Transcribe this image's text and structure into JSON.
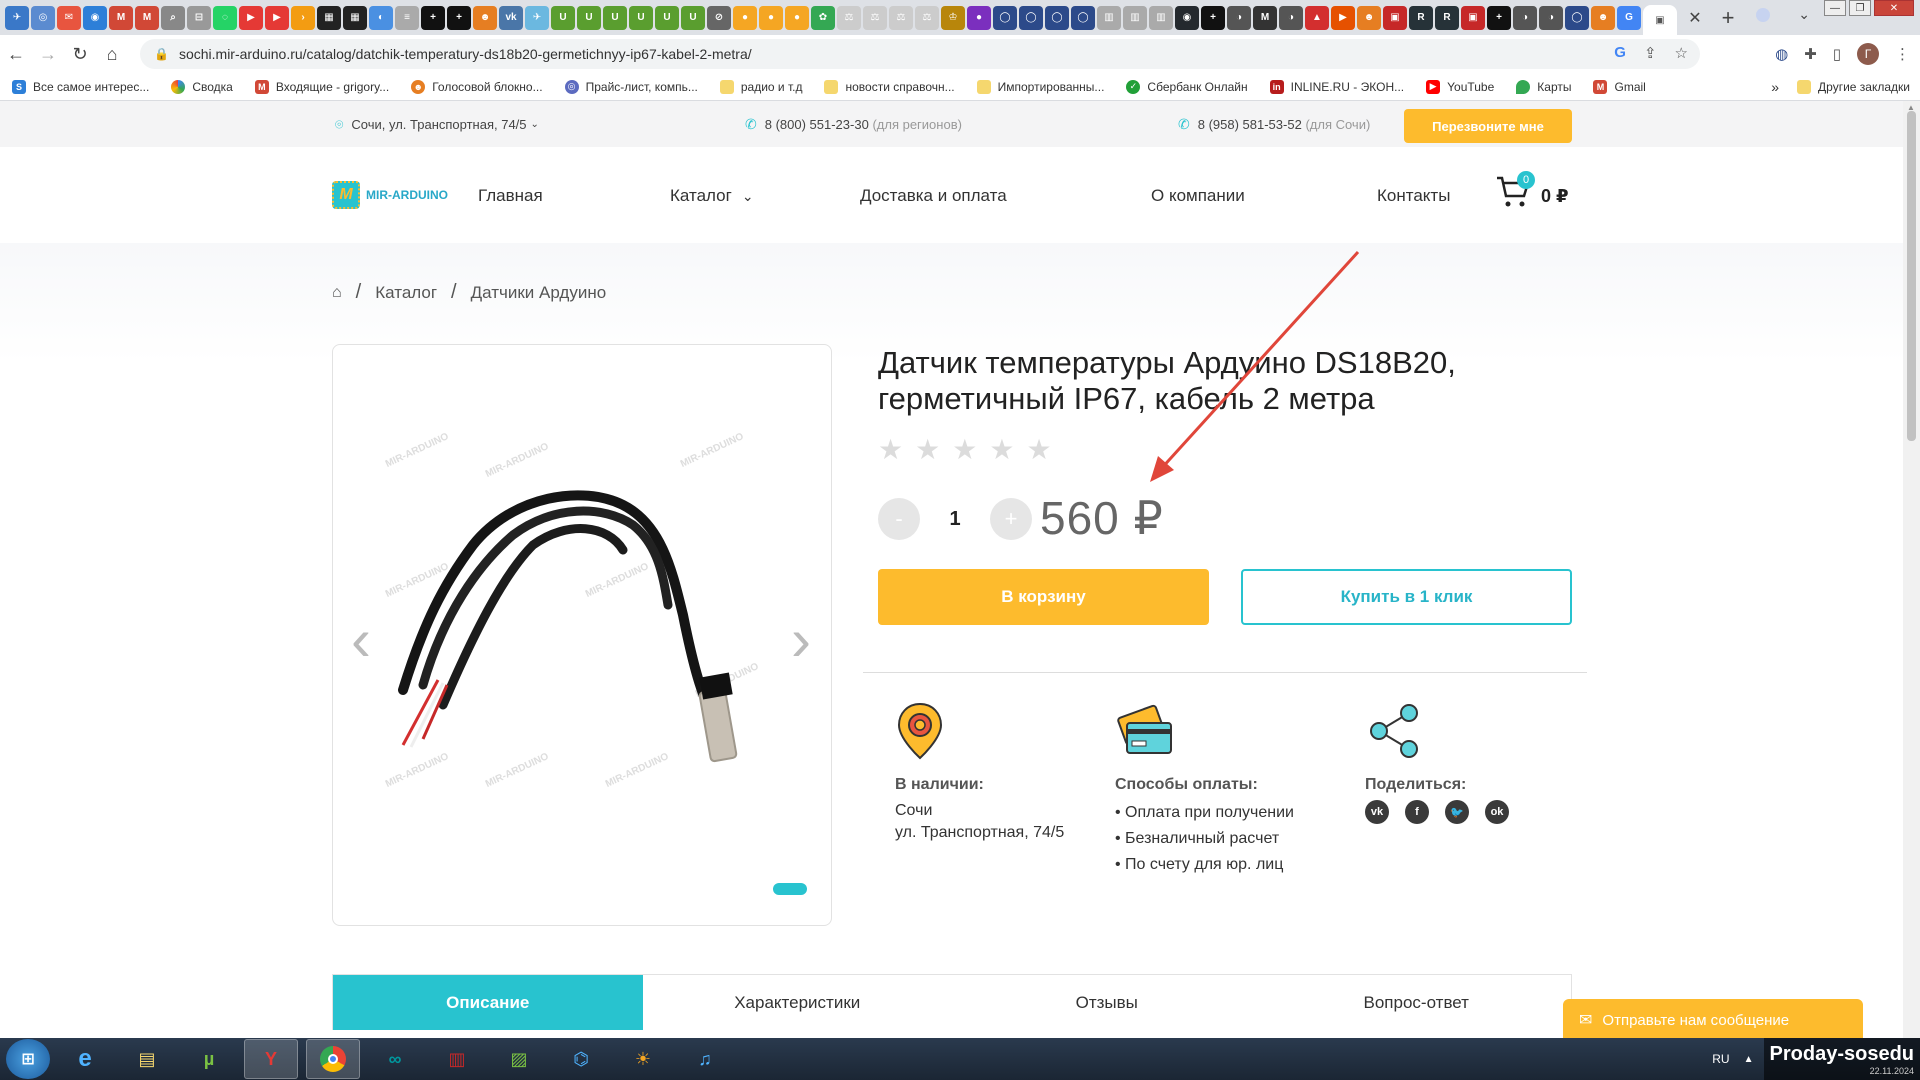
{
  "browser": {
    "url": "sochi.mir-arduino.ru/catalog/datchik-temperatury-ds18b20-germetichnyy-ip67-kabel-2-metra/",
    "bookmarks": [
      "Все самое интерес...",
      "Сводка",
      "Входящие - grigory...",
      "Голосовой блокно...",
      "Прайс-лист, компь...",
      "радио и т.д",
      "новости справочн...",
      "Импортированны...",
      "Сбербанк Онлайн",
      "INLINE.RU - ЭКОН...",
      "YouTube",
      "Карты",
      "Gmail"
    ],
    "bookmarks_more": "»",
    "other_bookmarks": "Другие закладки",
    "profile_initial": "Г"
  },
  "topbar": {
    "address": "Сочи, ул. Транспортная, 74/5",
    "phone1": "8 (800) 551-23-30",
    "phone1_note": "(для регионов)",
    "phone2": "8 (958) 581-53-52",
    "phone2_note": "(для Сочи)",
    "callback": "Перезвоните мне"
  },
  "nav": {
    "logo_text": "MIR-ARDUINO",
    "home": "Главная",
    "catalog": "Каталог",
    "delivery": "Доставка и оплата",
    "about": "О компании",
    "contacts": "Контакты",
    "cart_count": "0",
    "cart_sum": "0 ₽"
  },
  "breadcrumb": {
    "catalog": "Каталог",
    "category": "Датчики Ардуино"
  },
  "product": {
    "title": "Датчик температуры Ардуино DS18B20, герметичный IP67, кабель 2 метра",
    "rating": 0,
    "rating_max": 5,
    "qty": "1",
    "minus": "-",
    "plus": "+",
    "price": "560 ₽",
    "add_to_cart": "В корзину",
    "buy_one_click": "Купить в 1 клик",
    "watermark": "MIR-ARDUINO"
  },
  "info": {
    "stock_title": "В наличии:",
    "stock_city": "Сочи",
    "stock_address": "ул. Транспортная, 74/5",
    "pay_title": "Способы оплаты:",
    "pay_methods": [
      "Оплата при получении",
      "Безналичный расчет",
      "По счету для юр. лиц"
    ],
    "share_title": "Поделиться:"
  },
  "tabs": [
    "Описание",
    "Характеристики",
    "Отзывы",
    "Вопрос-ответ"
  ],
  "chat": "Отправьте нам сообщение",
  "taskbar": {
    "lang": "RU",
    "watermark": "Proday-sosedu",
    "date": "22.11.2024"
  },
  "colors": {
    "accent": "#28c3cf",
    "button": "#fdbb2d",
    "annotation": "#e0463a"
  }
}
